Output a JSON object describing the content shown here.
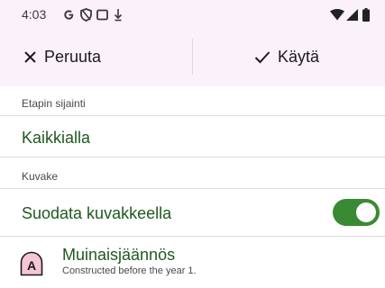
{
  "status_bar": {
    "time": "4:03",
    "icons": [
      "google-g-icon",
      "shield-icon",
      "square-icon",
      "download-icon",
      "wifi-icon",
      "signal-icon",
      "battery-icon"
    ]
  },
  "toolbar": {
    "cancel_label": "Peruuta",
    "apply_label": "Käytä"
  },
  "location": {
    "label": "Etapin sijainti",
    "value": "Kaikkialla"
  },
  "icon_section": {
    "label": "Kuvake",
    "filter_label": "Suodata kuvakkeella",
    "filter_enabled": true,
    "toggle_color": "#3a8a33"
  },
  "item": {
    "badge_letter": "A",
    "badge_color": "#f5c6d6",
    "title": "Muinaisjäännös",
    "description": "Constructed before the year 1."
  },
  "colors": {
    "header_bg": "#fbf1fb",
    "accent_text": "#1e5a1e"
  }
}
